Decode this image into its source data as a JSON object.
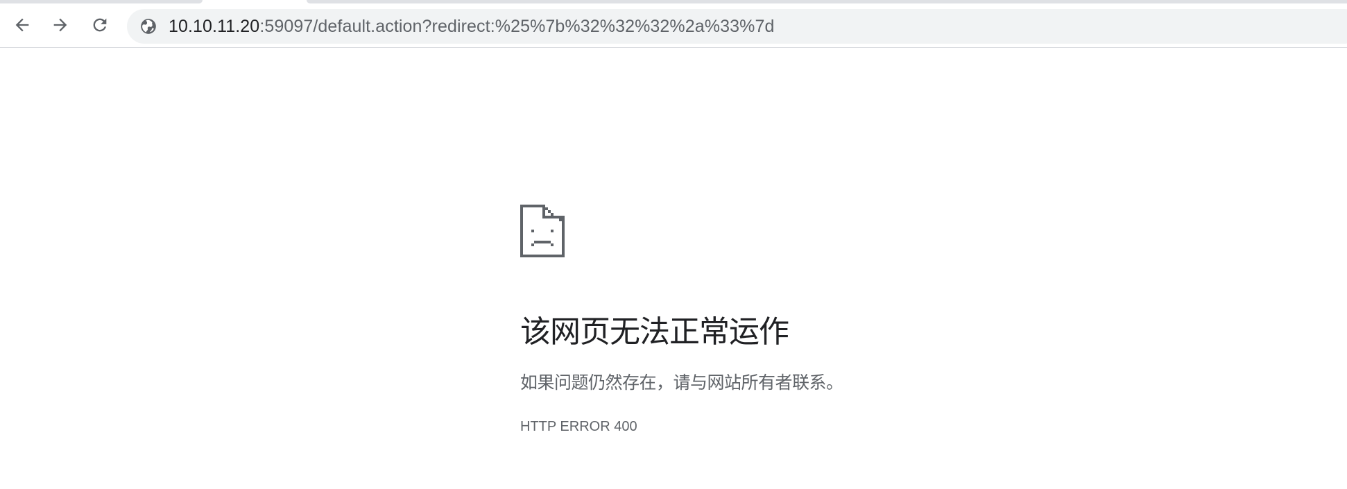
{
  "toolbar": {
    "back_icon": "arrow-left-icon",
    "forward_icon": "arrow-right-icon",
    "reload_icon": "reload-icon",
    "omnibox": {
      "site_icon": "globe-icon",
      "url_host": "10.10.11.20",
      "url_rest": ":59097/default.action?redirect:%25%7b%32%32%32%2a%33%7d"
    }
  },
  "error_page": {
    "icon": "sad-page-icon",
    "title": "该网页无法正常运作",
    "description": "如果问题仍然存在，请与网站所有者联系。",
    "error_code": "HTTP ERROR 400"
  },
  "colors": {
    "toolbar_bg": "#ffffff",
    "omnibox_bg": "#f1f3f4",
    "primary_text": "#202124",
    "secondary_text": "#5f6368",
    "icon_color": "#5f6368"
  }
}
